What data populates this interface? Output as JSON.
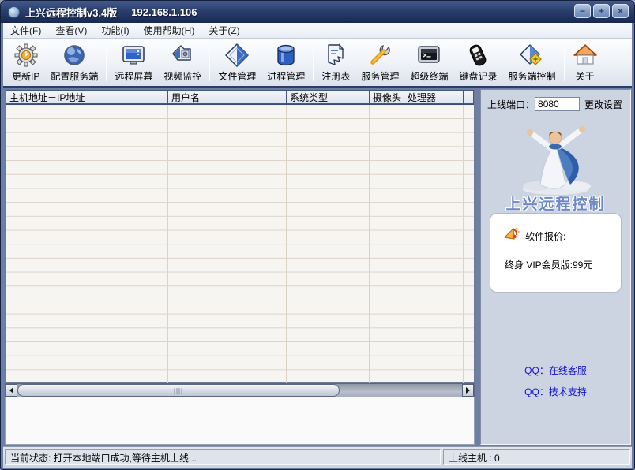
{
  "window": {
    "title": "上兴远程控制v3.4版",
    "ip": "192.168.1.106",
    "controls": {
      "minimize": "−",
      "maximize": "+",
      "close": "×"
    }
  },
  "menu": {
    "items": [
      {
        "label": "文件(F)"
      },
      {
        "label": "查看(V)"
      },
      {
        "label": "功能(I)"
      },
      {
        "label": "使用帮助(H)"
      },
      {
        "label": "关于(Z)"
      }
    ]
  },
  "toolbar": {
    "items": [
      {
        "label": "更新IP",
        "icon": "gear-icon"
      },
      {
        "label": "配置服务端",
        "icon": "globe-icon"
      },
      {
        "label": "远程屏幕",
        "icon": "monitor-icon"
      },
      {
        "label": "视频监控",
        "icon": "video-icon"
      },
      {
        "label": "文件管理",
        "icon": "file-icon"
      },
      {
        "label": "进程管理",
        "icon": "database-icon"
      },
      {
        "label": "注册表",
        "icon": "registry-icon"
      },
      {
        "label": "服务管理",
        "icon": "wrench-icon"
      },
      {
        "label": "超级终端",
        "icon": "terminal-icon"
      },
      {
        "label": "键盘记录",
        "icon": "keylogger-icon"
      },
      {
        "label": "服务端控制",
        "icon": "server-control-icon"
      },
      {
        "label": "关于",
        "icon": "home-icon"
      }
    ]
  },
  "host_table": {
    "columns": [
      "主机地址－IP地址",
      "用户名",
      "系统类型",
      "摄像头",
      "处理器",
      ""
    ],
    "rows": []
  },
  "right_panel": {
    "port_label": "上线端口：",
    "port_value": "8080",
    "change_settings_label": "更改设置",
    "logo_text": "上兴远程控制",
    "price_box": {
      "icon": "horn-icon",
      "title": "软件报价:",
      "detail": "终身 VIP会员版:99元"
    },
    "qq_links": [
      {
        "label": "QQ：在线客服"
      },
      {
        "label": "QQ：技术支持"
      }
    ]
  },
  "status_bar": {
    "current_status": "当前状态: 打开本地端口成功,等待主机上线...",
    "online_hosts": "上线主机 : 0"
  },
  "colors": {
    "titlebar_navy": "#243864",
    "accent_blue": "#2e62c4",
    "link_blue": "#1414cc",
    "panel_bg": "#ccd3e1",
    "grid_line": "#dcd3c7"
  }
}
